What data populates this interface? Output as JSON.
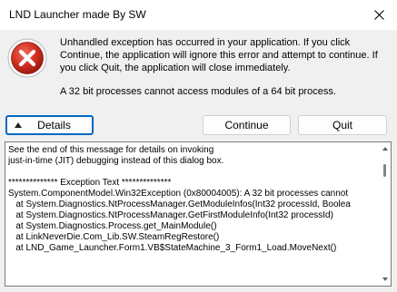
{
  "window": {
    "title": "LND Launcher made By SW",
    "close_icon": "close-icon"
  },
  "dialog": {
    "icon": "error-icon",
    "message": "Unhandled exception has occurred in your application. If you click Continue, the application will ignore this error and attempt to continue. If you click Quit, the application will close immediately.",
    "error_summary": "A 32 bit processes cannot access modules of a 64 bit process."
  },
  "buttons": {
    "details_label": "Details",
    "continue_label": "Continue",
    "quit_label": "Quit"
  },
  "details": {
    "text": "See the end of this message for details on invoking\njust-in-time (JIT) debugging instead of this dialog box.\n\n************** Exception Text **************\nSystem.ComponentModel.Win32Exception (0x80004005): A 32 bit processes cannot\n   at System.Diagnostics.NtProcessManager.GetModuleInfos(Int32 processId, Boolea\n   at System.Diagnostics.NtProcessManager.GetFirstModuleInfo(Int32 processId)\n   at System.Diagnostics.Process.get_MainModule()\n   at LinkNeverDie.Com_Lib.SW.SteamRegRestore()\n   at LND_Game_Launcher.Form1.VB$StateMachine_3_Form1_Load.MoveNext()"
  },
  "colors": {
    "accent": "#0067c0",
    "error_red": "#c42b1c",
    "background": "#f0f0f0"
  }
}
